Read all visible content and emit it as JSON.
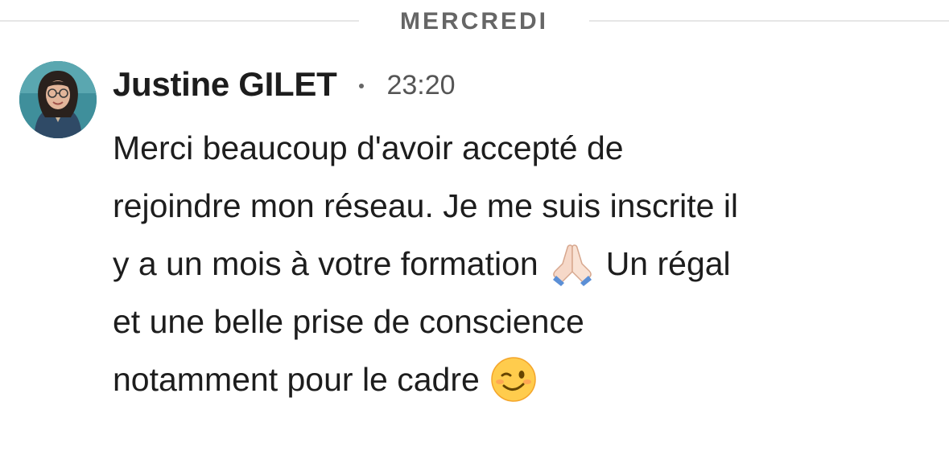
{
  "day_divider": {
    "label": "MERCREDI"
  },
  "message": {
    "sender_name": "Justine GILET",
    "time": "23:20",
    "avatar_icon": "profile-photo",
    "lines": [
      {
        "text": "Merci beaucoup d'avoir accepté de"
      },
      {
        "text": "rejoindre mon réseau. Je me suis inscrite il"
      },
      {
        "before": "y a un mois à votre formation",
        "emoji": "folded-hands-icon",
        "after": "Un régal"
      },
      {
        "text": "et une belle prise de conscience"
      },
      {
        "before": "notamment pour le cadre",
        "emoji": "winking-face-icon"
      }
    ]
  },
  "colors": {
    "text_primary": "#1d1d1d",
    "text_secondary": "#666666",
    "divider": "#e6e6e6",
    "background": "#ffffff"
  }
}
